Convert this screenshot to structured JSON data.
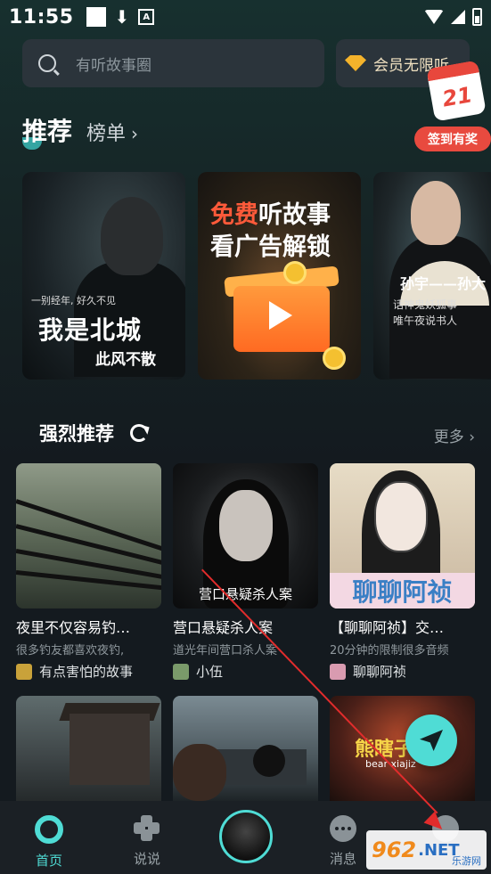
{
  "status_bar": {
    "time": "11:55"
  },
  "search": {
    "placeholder": "有听故事圈"
  },
  "vip": {
    "label": "会员无限听"
  },
  "checkin": {
    "day": "21",
    "label": "签到有奖"
  },
  "tabs": {
    "recommend": "推荐",
    "ranking": "榜单",
    "ranking_chevron": "›"
  },
  "banners": [
    {
      "small_text": "一别经年, 好久不见",
      "title": "我是北城",
      "subtitle": "此风不散"
    },
    {
      "title_red": "免费",
      "title_rest": "听故事",
      "title_line2": "看广告解锁"
    },
    {
      "line1": "孙宇——孙大",
      "line2": "话神鬼妖狐事",
      "line3": "唯午夜说书人"
    }
  ],
  "section": {
    "title": "强烈推荐",
    "more": "更多 ›"
  },
  "cards": [
    {
      "title": "夜里不仅容易钓…",
      "desc": "很多钓友都喜欢夜钓,",
      "author": "有点害怕的故事"
    },
    {
      "title": "营口悬疑杀人案",
      "desc": "道光年间营口杀人案",
      "author": "小伍",
      "cover_caption": "营口悬疑杀人案"
    },
    {
      "title": "【聊聊阿祯】交…",
      "desc": "20分钟的限制很多音频",
      "author": "聊聊阿祯",
      "cover_band": "聊聊阿祯"
    }
  ],
  "row2": {
    "card3_title": "熊瞎子",
    "card3_sub": "bear xiajiz"
  },
  "nav": {
    "home": "首页",
    "talk": "说说",
    "message": "消息"
  },
  "watermark": {
    "num": "962",
    "net": ".NET",
    "sub": "乐游网"
  },
  "colors": {
    "accent": "#4fdcd5",
    "checkin": "#e84a3f",
    "vip_gold": "#f4b32b",
    "annotation_arrow": "#e12c2c"
  }
}
